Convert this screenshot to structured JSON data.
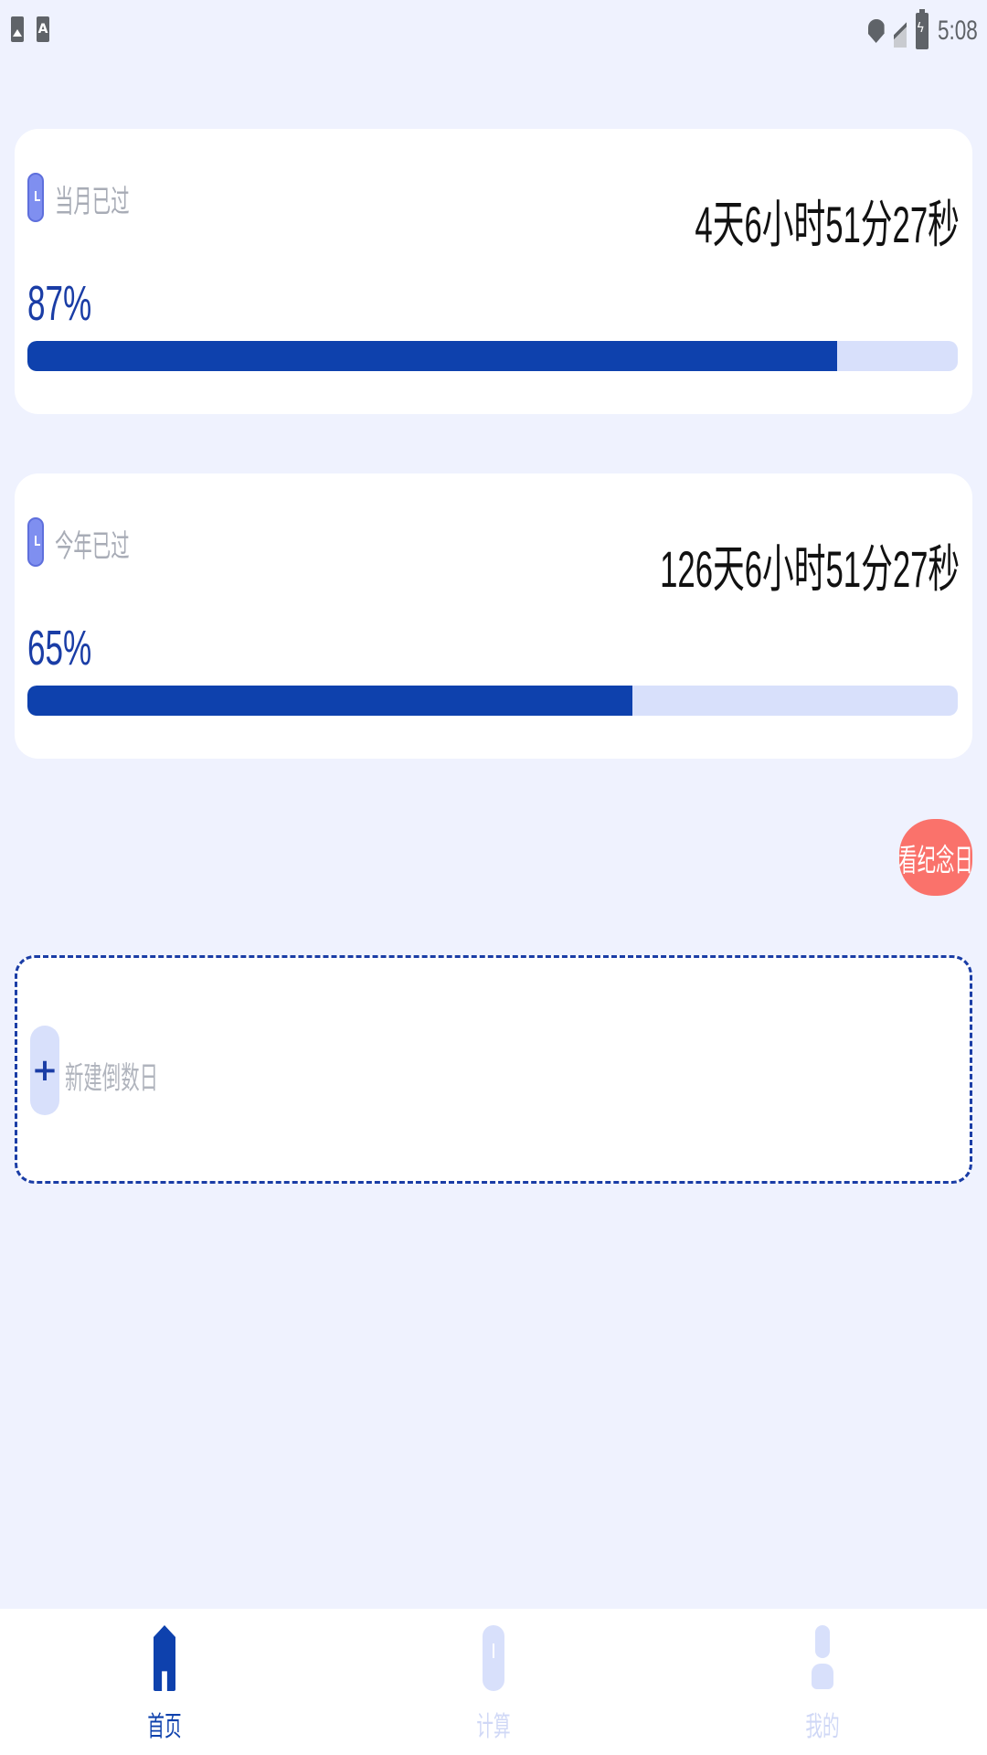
{
  "status_bar": {
    "time": "5:08",
    "left_icons": [
      "photo-icon",
      "a-icon"
    ],
    "right_icons": [
      "location-icon",
      "signal-icon",
      "battery-charging-icon"
    ]
  },
  "month_card": {
    "label": "当月已过",
    "remaining": "4天6小时51分27秒",
    "percent_text": "87%",
    "progress": 0.87
  },
  "year_card": {
    "label": "今年已过",
    "remaining": "126天6小时51分27秒",
    "percent_text": "65%",
    "progress": 0.65
  },
  "anniversary_button": {
    "label": "看纪念日"
  },
  "new_countdown": {
    "label": "新建倒数日",
    "icon": "plus-icon"
  },
  "bottom_nav": {
    "items": [
      {
        "label": "首页",
        "icon": "home-icon",
        "active": true
      },
      {
        "label": "计算",
        "icon": "clock-icon",
        "active": false
      },
      {
        "label": "我的",
        "icon": "person-icon",
        "active": false
      }
    ]
  },
  "colors": {
    "background": "#eff2fe",
    "primary": "#0e41ad",
    "progress_track": "#d8e0fb",
    "accent_button": "#fa726b"
  }
}
